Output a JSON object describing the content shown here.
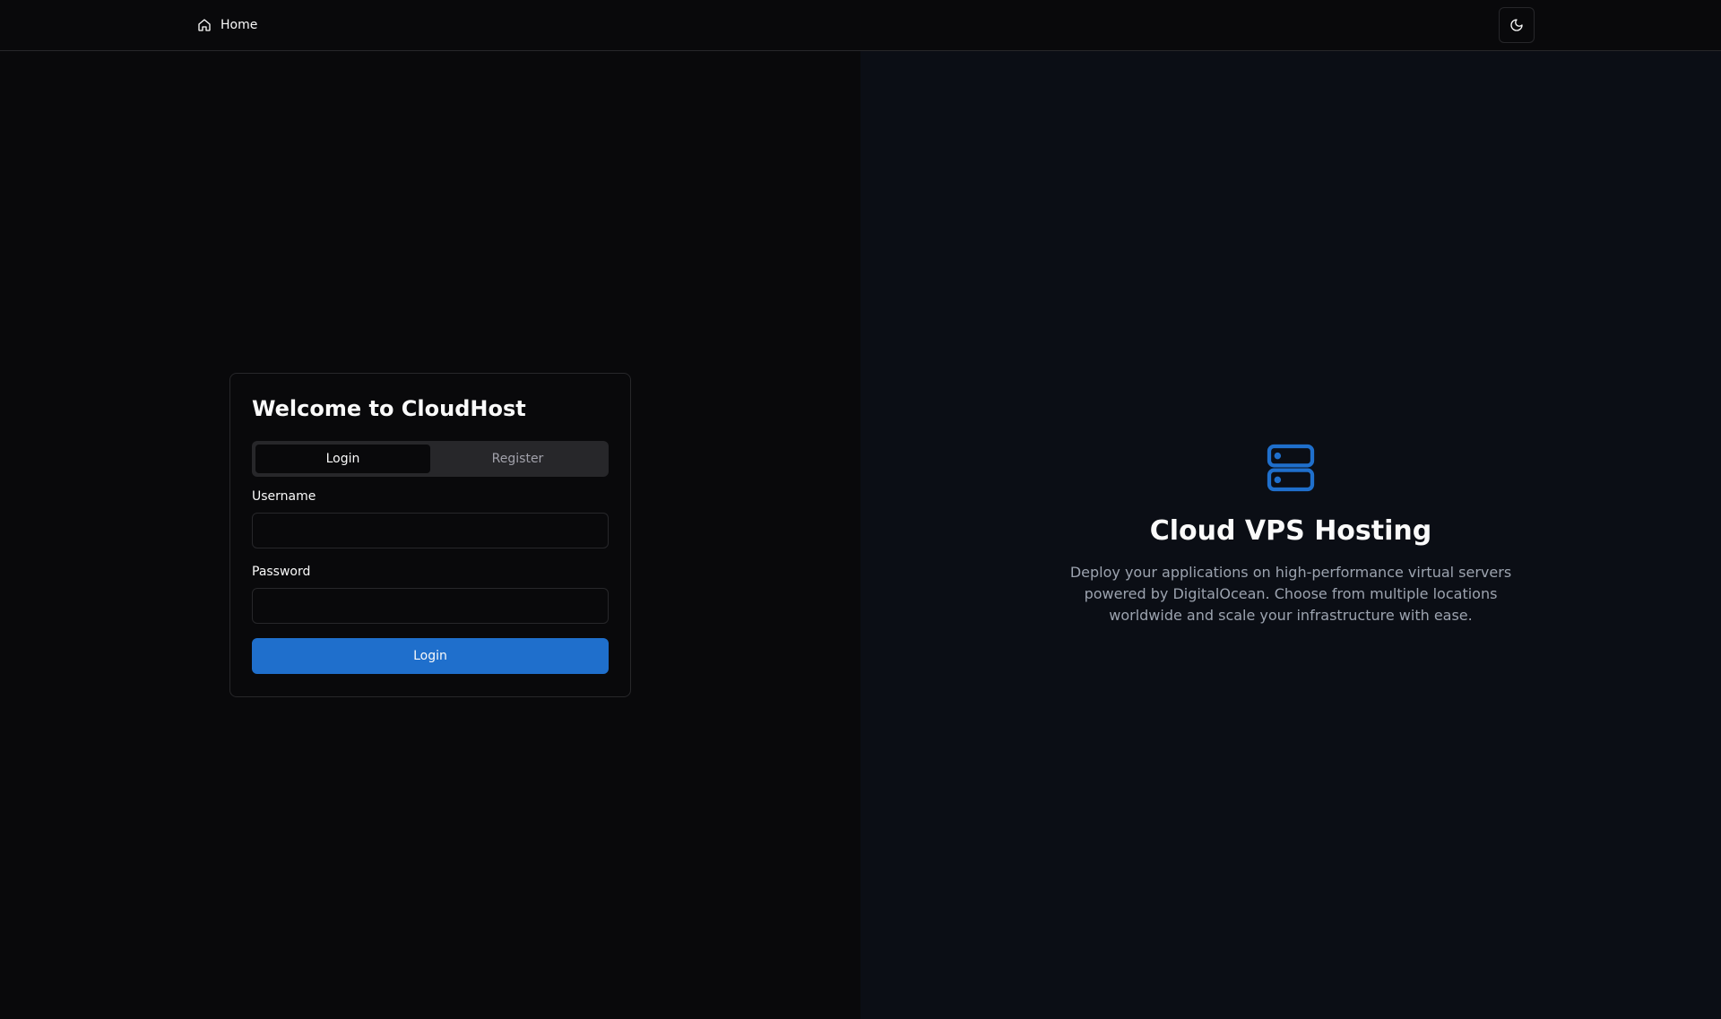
{
  "nav": {
    "home_label": "Home",
    "home_icon": "home-icon",
    "theme_icon": "moon-icon"
  },
  "login_card": {
    "title": "Welcome to CloudHost",
    "tabs": [
      {
        "label": "Login",
        "active": true
      },
      {
        "label": "Register",
        "active": false
      }
    ],
    "username_label": "Username",
    "username_value": "",
    "password_label": "Password",
    "password_value": "",
    "submit_label": "Login"
  },
  "hero": {
    "icon": "server-icon",
    "title": "Cloud VPS Hosting",
    "description": "Deploy your applications on high-performance virtual servers powered by DigitalOcean. Choose from multiple locations worldwide and scale your infrastructure with ease."
  },
  "colors": {
    "accent": "#1f6fcc",
    "background": "#09090b",
    "hero_background": "#0b0e15",
    "muted_text": "#9ca3af",
    "border": "#27272a"
  }
}
